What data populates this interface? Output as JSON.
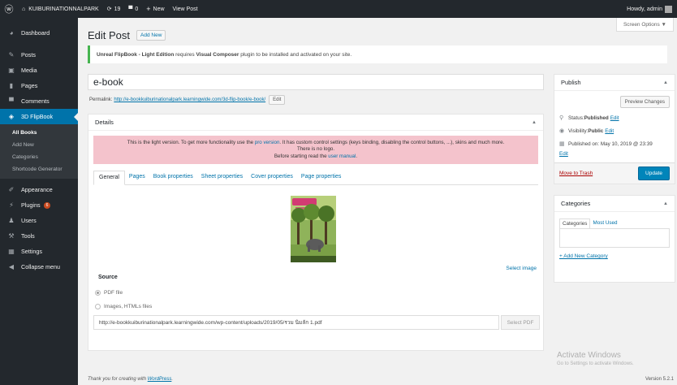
{
  "adminbar": {
    "site_name": "KUIBURINATIONNALPARK",
    "updates_count": "19",
    "comments_count": "0",
    "new_label": "New",
    "view_post": "View Post",
    "howdy": "Howdy, admin"
  },
  "sidebar": {
    "items": [
      {
        "label": "Dashboard",
        "icon": "dashboard-icon"
      },
      {
        "label": "Posts",
        "icon": "pin-icon"
      },
      {
        "label": "Media",
        "icon": "media-icon"
      },
      {
        "label": "Pages",
        "icon": "page-icon"
      },
      {
        "label": "Comments",
        "icon": "comment-icon"
      },
      {
        "label": "3D FlipBook",
        "icon": "book-icon"
      }
    ],
    "submenu": [
      "All Books",
      "Add New",
      "Categories",
      "Shortcode Generator"
    ],
    "items2": [
      {
        "label": "Appearance",
        "icon": "brush-icon"
      },
      {
        "label": "Plugins",
        "icon": "plug-icon",
        "badge": "6"
      },
      {
        "label": "Users",
        "icon": "user-icon"
      },
      {
        "label": "Tools",
        "icon": "wrench-icon"
      },
      {
        "label": "Settings",
        "icon": "settings-icon"
      },
      {
        "label": "Collapse menu",
        "icon": "collapse-icon"
      }
    ]
  },
  "screen_options": "Screen Options ▼",
  "page": {
    "title": "Edit Post",
    "add_new": "Add New"
  },
  "notice": {
    "plugin_name": "Unreal FlipBook - Light Edition",
    "text1": " requires ",
    "required": "Visual Composer",
    "text2": " plugin to be installed and activated on your site."
  },
  "post": {
    "title": "e-book",
    "permalink_label": "Permalink:",
    "permalink_url": "http://e-bookkuiburinationalpark.learningwide.com/3d-flip-book/e-book/",
    "edit_label": "Edit"
  },
  "details": {
    "heading": "Details",
    "lite_line1a": "This is the light version. To get more functionality use the ",
    "lite_link1": "pro version",
    "lite_line1b": ". It has custom control settings (keys binding, disabling the control buttons, ...), skins and much more.",
    "lite_line2": "There is no logo.",
    "lite_line3a": "Before starting read the ",
    "lite_link2": "user manual",
    "lite_line3b": ".",
    "tabs": [
      "General",
      "Pages",
      "Book properties",
      "Sheet properties",
      "Cover properties",
      "Page properties"
    ],
    "select_image": "Select image",
    "source_label": "Source",
    "source_options": [
      "PDF file",
      "Images, HTMLs files"
    ],
    "pdf_url": "http://e-bookkuiburinationalpark.learningwide.com/wp-content/uploads/2019/05/รวม นิมลัก 1.pdf",
    "select_pdf": "Select PDF"
  },
  "publish": {
    "heading": "Publish",
    "preview": "Preview Changes",
    "status_label": "Status: ",
    "status_value": "Published",
    "visibility_label": "Visibility: ",
    "visibility_value": "Public",
    "published_on": "Published on: May 10, 2019 @ 23:39",
    "edit": "Edit",
    "trash": "Move to Trash",
    "update": "Update"
  },
  "categories": {
    "heading": "Categories",
    "tab_all": "Categories",
    "tab_used": "Most Used",
    "add_new": "+ Add New Category"
  },
  "watermark": {
    "title": "Activate Windows",
    "subtitle": "Go to Settings to activate Windows."
  },
  "footer": {
    "thanks_a": "Thank you for creating with ",
    "thanks_link": "WordPress",
    "thanks_b": ".",
    "version": "Version 5.2.1"
  },
  "colors": {
    "admin_dark": "#23282d",
    "accent": "#0073aa",
    "notice_green": "#46b450",
    "lite_notice_bg": "#f4c3cc",
    "update_button": "#0085ba"
  }
}
